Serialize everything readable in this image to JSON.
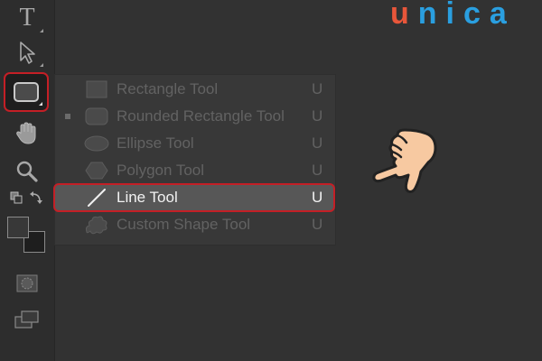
{
  "logo": {
    "first_letter": "u",
    "rest": "nica"
  },
  "toolbar": {
    "type_glyph": "T",
    "tools": [
      {
        "name": "type-tool",
        "icon": "type-icon"
      },
      {
        "name": "move-tool",
        "icon": "arrow-cursor-icon"
      },
      {
        "name": "shape-tool",
        "icon": "rounded-rectangle-icon",
        "selected": true
      },
      {
        "name": "hand-tool",
        "icon": "hand-icon"
      },
      {
        "name": "zoom-tool",
        "icon": "magnifier-icon"
      },
      {
        "name": "swap-colors",
        "icon": "swap-colors-icon"
      },
      {
        "name": "color-swatches",
        "icon": "foreground-background-icon"
      },
      {
        "name": "quick-mask",
        "icon": "quick-mask-icon"
      },
      {
        "name": "screen-mode",
        "icon": "screen-mode-icon"
      }
    ]
  },
  "flyout": {
    "items": [
      {
        "label": "Rectangle Tool",
        "shortcut": "U",
        "icon": "rectangle-icon"
      },
      {
        "label": "Rounded Rectangle Tool",
        "shortcut": "U",
        "icon": "rounded-rectangle-icon",
        "current": true
      },
      {
        "label": "Ellipse Tool",
        "shortcut": "U",
        "icon": "ellipse-icon"
      },
      {
        "label": "Polygon Tool",
        "shortcut": "U",
        "icon": "polygon-icon"
      },
      {
        "label": "Line Tool",
        "shortcut": "U",
        "icon": "line-icon",
        "highlighted": true
      },
      {
        "label": "Custom Shape Tool",
        "shortcut": "U",
        "icon": "custom-shape-icon"
      }
    ]
  },
  "colors": {
    "background": "#323232",
    "toolbar": "#2d2d2d",
    "flyout": "#383838",
    "highlight": "#575757",
    "annotation_red": "#c41f26",
    "logo_orange": "#e8563a",
    "logo_blue": "#2a9fe0"
  }
}
